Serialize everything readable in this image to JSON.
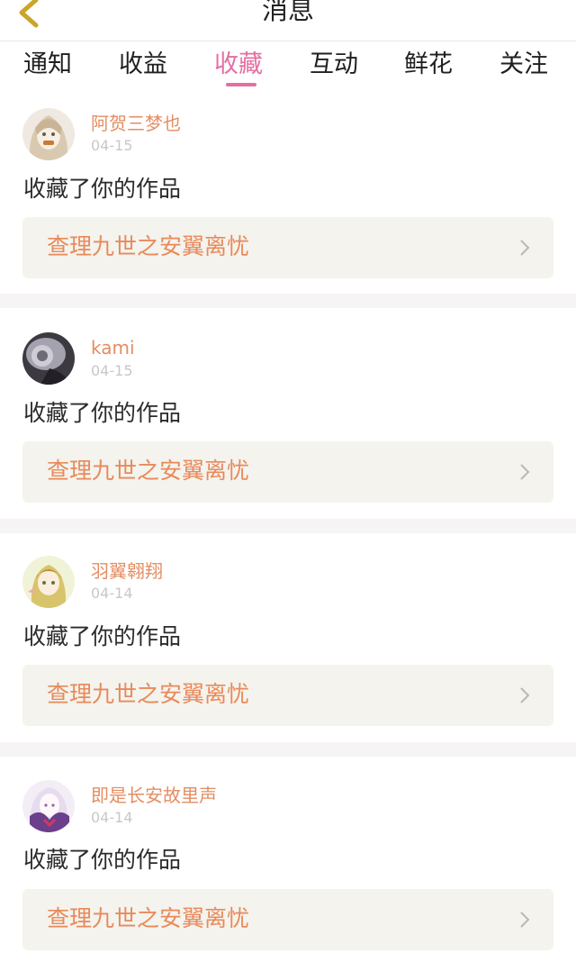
{
  "header": {
    "title": "消息"
  },
  "tabs": [
    {
      "label": "通知"
    },
    {
      "label": "收益"
    },
    {
      "label": "收藏",
      "active": true
    },
    {
      "label": "互动"
    },
    {
      "label": "鲜花"
    },
    {
      "label": "关注"
    }
  ],
  "colors": {
    "accent": "#e46fa2",
    "username": "#e48d62",
    "link": "#e88a5a"
  },
  "items": [
    {
      "username": "阿贺三梦也",
      "date": "04-15",
      "action": "收藏了你的作品",
      "work": "查理九世之安翼离忧",
      "avatar_icon": "avatar-icon"
    },
    {
      "username": "kami",
      "date": "04-15",
      "action": "收藏了你的作品",
      "work": "查理九世之安翼离忧",
      "avatar_icon": "avatar-icon"
    },
    {
      "username": "羽翼翱翔",
      "date": "04-14",
      "action": "收藏了你的作品",
      "work": "查理九世之安翼离忧",
      "avatar_icon": "avatar-icon"
    },
    {
      "username": "即是长安故里声",
      "date": "04-14",
      "action": "收藏了你的作品",
      "work": "查理九世之安翼离忧",
      "avatar_icon": "avatar-icon"
    }
  ]
}
